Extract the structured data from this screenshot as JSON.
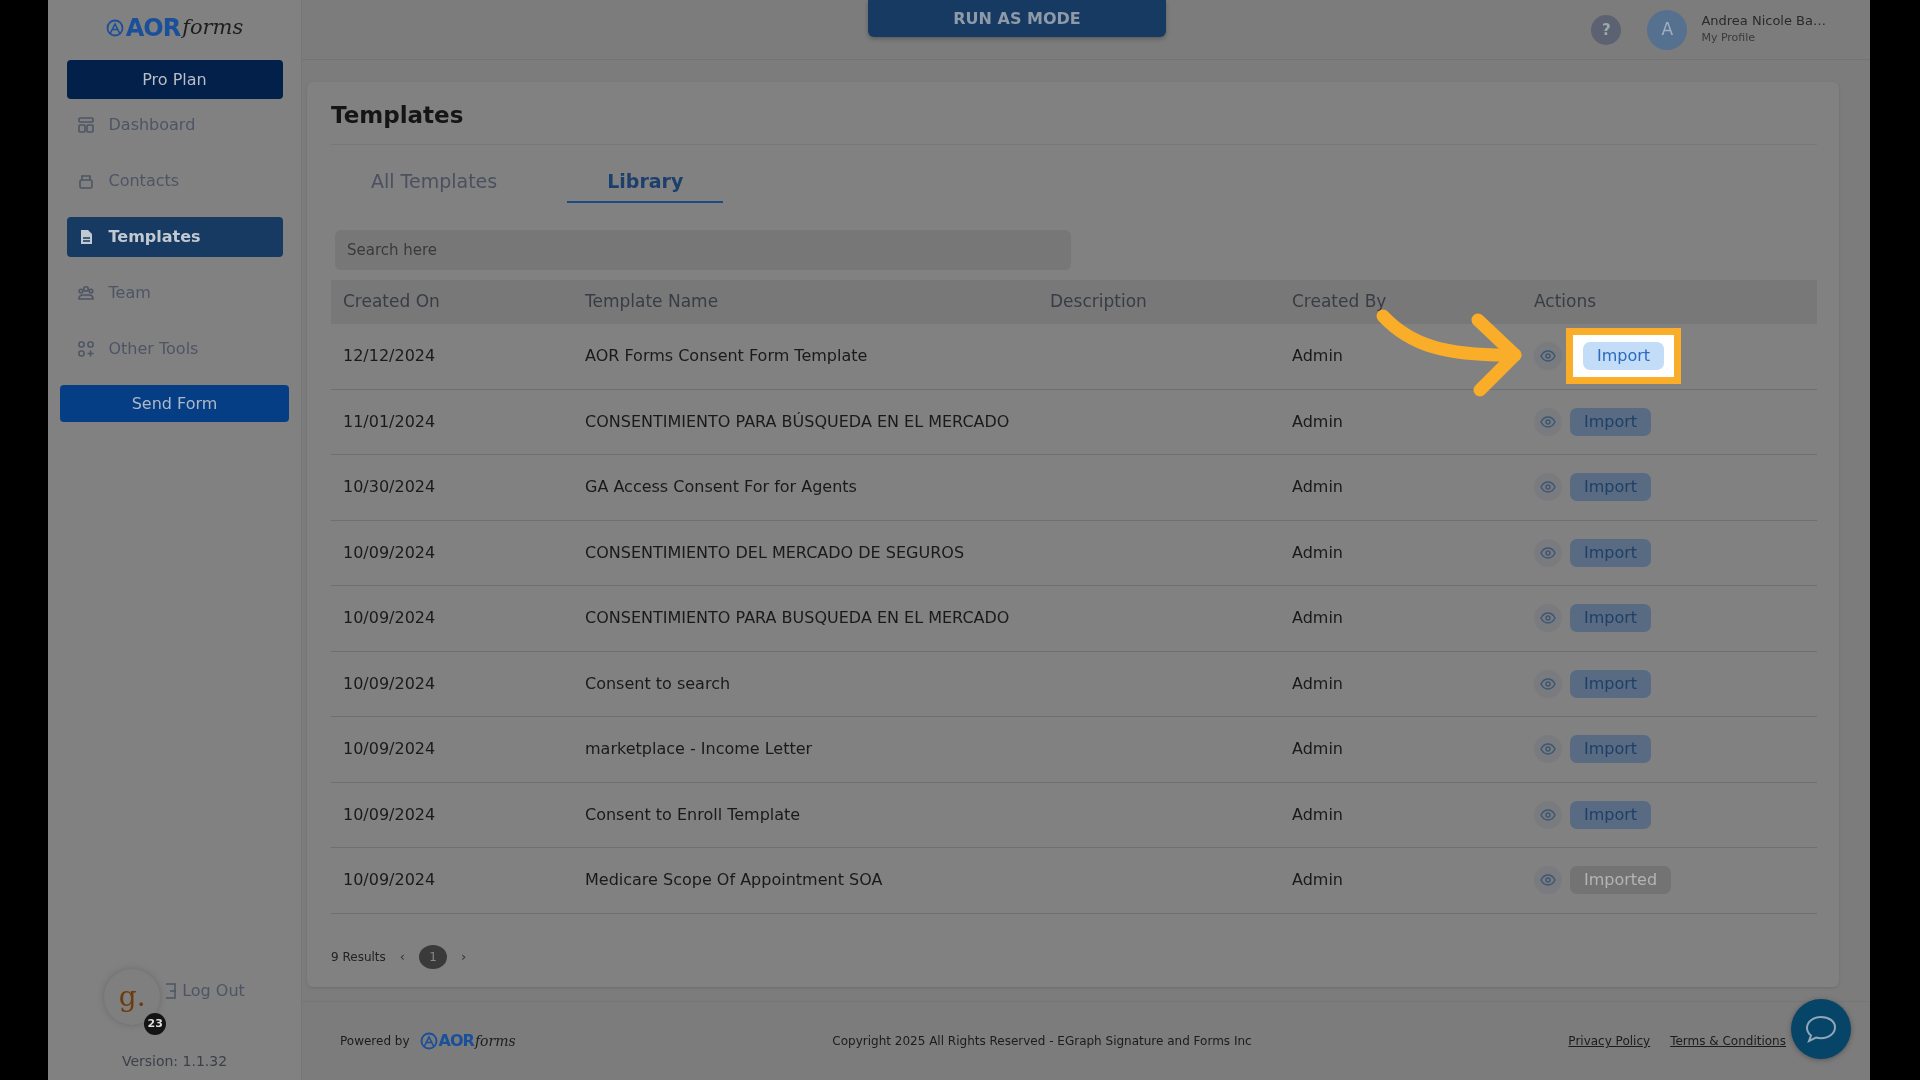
{
  "sidebar": {
    "logo": {
      "bold": "AOR",
      "script": "forms"
    },
    "plan": "Pro Plan",
    "items": [
      {
        "label": "Dashboard",
        "selected": false
      },
      {
        "label": "Contacts",
        "selected": false
      },
      {
        "label": "Templates",
        "selected": true
      },
      {
        "label": "Team",
        "selected": false
      },
      {
        "label": "Other Tools",
        "selected": false
      }
    ],
    "send_button": "Send Form",
    "user_badge": {
      "letter": "g.",
      "count": "23"
    },
    "logout": "Log Out",
    "version": "Version: 1.1.32"
  },
  "header": {
    "run_as": "RUN AS MODE",
    "help": "?",
    "profile": {
      "initial": "A",
      "name": "Andrea Nicole Ba…",
      "subtitle": "My Profile"
    }
  },
  "page": {
    "title": "Templates",
    "tabs": [
      {
        "label": "All Templates",
        "selected": false
      },
      {
        "label": "Library",
        "selected": true
      }
    ],
    "search": {
      "placeholder": "Search here"
    },
    "table": {
      "columns": [
        "Created On",
        "Template Name",
        "Description",
        "Created By",
        "Actions"
      ],
      "rows": [
        {
          "created_on": "12/12/2024",
          "name": "AOR Forms Consent Form Template",
          "created_by": "Admin",
          "action": "Import",
          "disabled": false,
          "highlighted": true
        },
        {
          "created_on": "11/01/2024",
          "name": "CONSENTIMIENTO PARA BÚSQUEDA EN EL MERCADO",
          "created_by": "Admin",
          "action": "Import",
          "disabled": false,
          "highlighted": false
        },
        {
          "created_on": "10/30/2024",
          "name": "GA Access Consent For for Agents",
          "created_by": "Admin",
          "action": "Import",
          "disabled": false,
          "highlighted": false
        },
        {
          "created_on": "10/09/2024",
          "name": "CONSENTIMIENTO DEL MERCADO DE SEGUROS",
          "created_by": "Admin",
          "action": "Import",
          "disabled": false,
          "highlighted": false
        },
        {
          "created_on": "10/09/2024",
          "name": "CONSENTIMIENTO PARA BUSQUEDA EN EL MERCADO",
          "created_by": "Admin",
          "action": "Import",
          "disabled": false,
          "highlighted": false
        },
        {
          "created_on": "10/09/2024",
          "name": "Consent to search",
          "created_by": "Admin",
          "action": "Import",
          "disabled": false,
          "highlighted": false
        },
        {
          "created_on": "10/09/2024",
          "name": "marketplace - Income Letter",
          "created_by": "Admin",
          "action": "Import",
          "disabled": false,
          "highlighted": false
        },
        {
          "created_on": "10/09/2024",
          "name": "Consent to Enroll Template",
          "created_by": "Admin",
          "action": "Import",
          "disabled": false,
          "highlighted": false
        },
        {
          "created_on": "10/09/2024",
          "name": "Medicare Scope Of Appointment SOA",
          "created_by": "Admin",
          "action": "Imported",
          "disabled": true,
          "highlighted": false
        }
      ]
    },
    "pagination": {
      "summary": "9 Results",
      "prev": "‹",
      "pages": [
        {
          "label": "1",
          "selected": true
        }
      ],
      "next": "›"
    }
  },
  "footer": {
    "powered_by": "Powered by",
    "logo": {
      "bold": "AOR",
      "script": "forms"
    },
    "copyright": "Copyright 2025 All Rights Reserved - EGraph Signature and Forms Inc",
    "links": [
      "Privacy Policy",
      "Terms & Conditions"
    ]
  }
}
